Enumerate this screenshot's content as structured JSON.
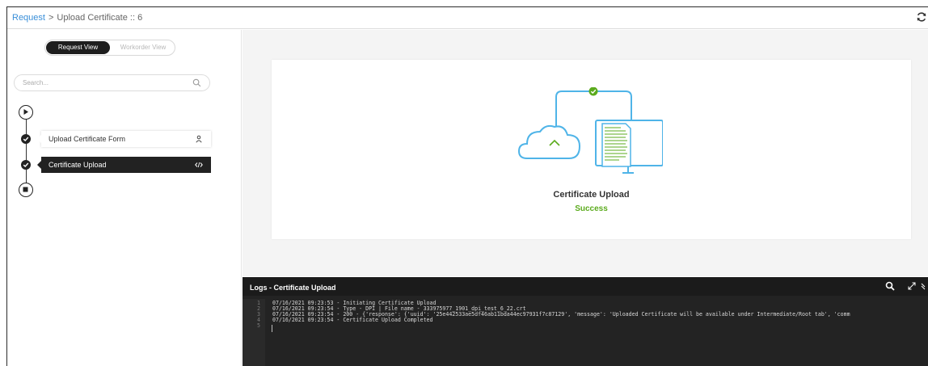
{
  "breadcrumb": {
    "root": "Request",
    "separator": ">",
    "current": "Upload Certificate :: 6"
  },
  "toggle": {
    "request_view": "Request View",
    "workorder_view": "Workorder View"
  },
  "search": {
    "placeholder": "Search..."
  },
  "flow": {
    "items": [
      {
        "label": "Upload Certificate Form",
        "icon": "user-icon",
        "active": false
      },
      {
        "label": "Certificate Upload",
        "icon": "code-icon",
        "active": true
      }
    ]
  },
  "status_card": {
    "title": "Certificate Upload",
    "status": "Success"
  },
  "logs": {
    "title": "Logs - Certificate Upload",
    "lines": [
      {
        "num": "1",
        "text": "07/16/2021 09:23:53  - Initiating Certificate Upload"
      },
      {
        "num": "2",
        "text": "07/16/2021 09:23:54  - Type - DPI | File name - 333975977_1901_dpi_test_6_22.crt"
      },
      {
        "num": "3",
        "text": "07/16/2021 09:23:54  - 200 - {'response': {'uuid': '25e442533ae5df46ab11bda44ec97931f7c87129', 'message': 'Uploaded Certificate will be available under Intermediate/Root tab', 'comm"
      },
      {
        "num": "4",
        "text": "07/16/2021 09:23:54  - Certificate Upload Completed"
      },
      {
        "num": "5",
        "text": ""
      }
    ]
  },
  "colors": {
    "accent_link": "#3a8fd9",
    "success": "#5bab1d",
    "illustration": "#4fb4e8",
    "dark": "#222222"
  }
}
